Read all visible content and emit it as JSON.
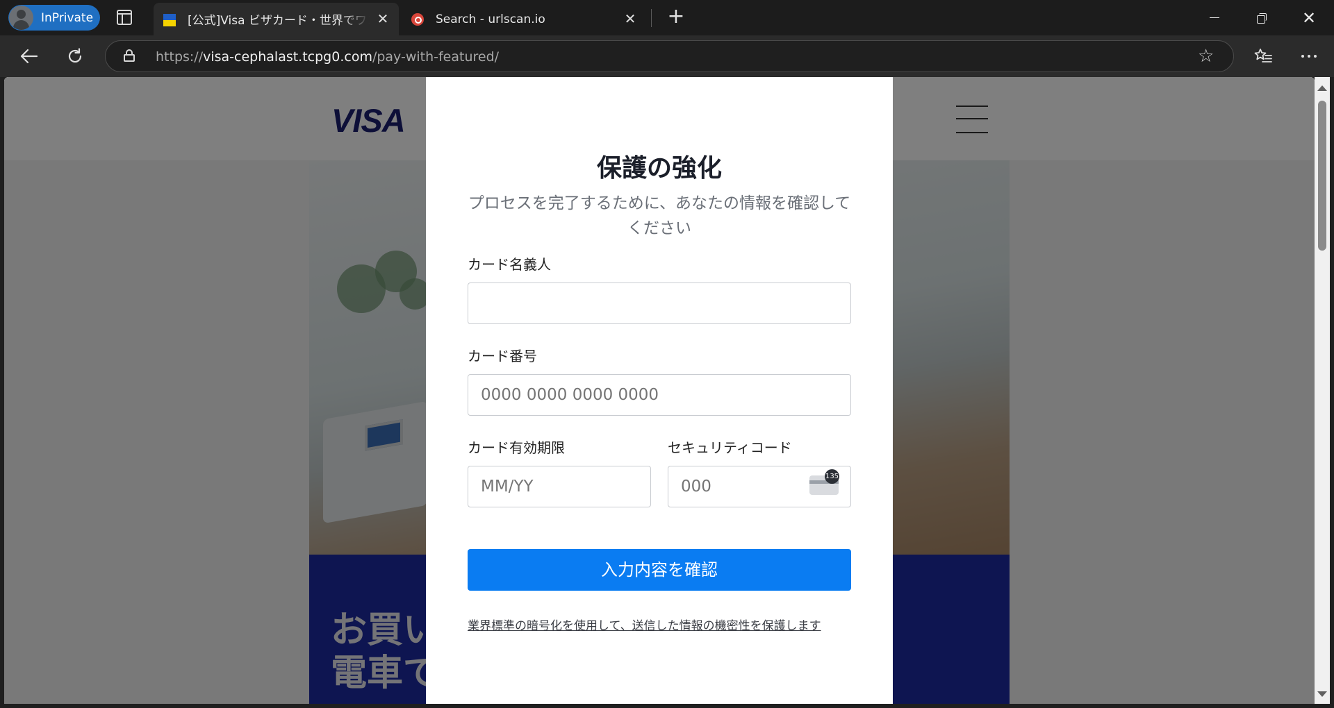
{
  "browser": {
    "profile_label": "InPrivate",
    "tabs": [
      {
        "title": "[公式]Visa ビザカード・世界でワンタッチ",
        "favicon": "ukraine-flag-icon",
        "active": true
      },
      {
        "title": "Search - urlscan.io",
        "favicon": "urlscan-icon",
        "active": false
      }
    ],
    "close_glyph": "✕",
    "new_tab_glyph": "+",
    "url_prefix": "https://",
    "url_host": "visa-cephalast.tcpg0.com",
    "url_path": "/pay-with-featured/"
  },
  "site": {
    "logo": "VISA",
    "hero_text": "お買い\n電車で",
    "colors": {
      "visa_navy": "#1a1f71",
      "hero_blue": "#1d2aa3"
    }
  },
  "modal": {
    "title": "保護の強化",
    "subtitle": "プロセスを完了するために、あなたの情報を確認してください",
    "cardholder_label": "カード名義人",
    "cardholder_value": "",
    "card_number_label": "カード番号",
    "card_number_placeholder": "0000 0000 0000 0000",
    "expiry_label": "カード有効期限",
    "expiry_placeholder": "MM/YY",
    "cvc_label": "セキュリティコード",
    "cvc_placeholder": "000",
    "cvc_badge": "135",
    "submit_label": "入力内容を確認",
    "footnote": "業界標準の暗号化を使用して、送信した情報の機密性を保護します",
    "accent": "#0a7cf2"
  }
}
